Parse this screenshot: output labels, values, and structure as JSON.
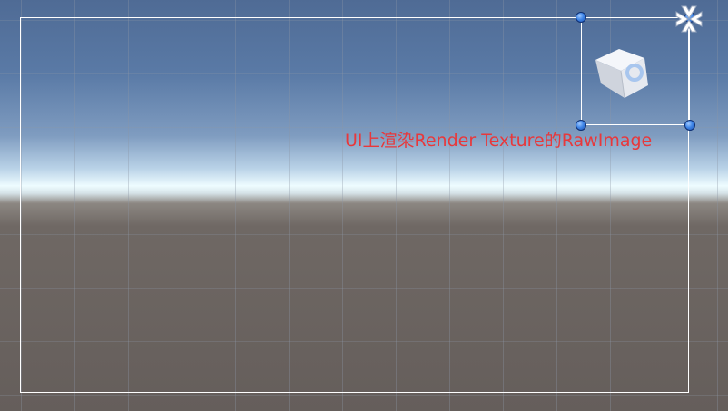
{
  "scene": {
    "annotation_text": "UI上渲染Render Texture的RawImage",
    "annotation_color": "#e8383b",
    "sky_color": "#5a7aa6",
    "horizon_color": "#eefcff",
    "ground_color": "#655e5b",
    "selection_color": "#ffffff",
    "handle_color": "#3f86e8"
  },
  "icons": {
    "pivot": "anchor-pivot-icon",
    "cube": "cube-gameobject-icon"
  }
}
